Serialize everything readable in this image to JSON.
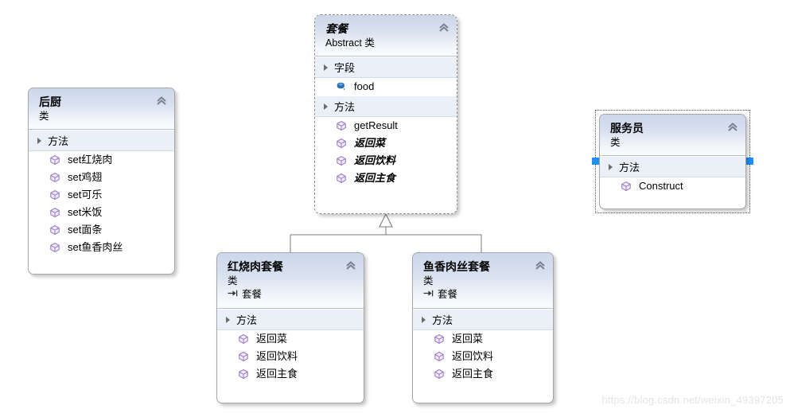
{
  "diagram": {
    "kind": "uml-class-diagram",
    "background": "#ffffff",
    "watermark": "https://blog.csdn.net/weixin_49397205",
    "colors": {
      "header_gradient_top": "#ccd7ea",
      "header_gradient_bottom": "#fbfcfe",
      "section_background": "#eaeff8",
      "shape_border": "#a6a6a6",
      "abstract_border": "#8c8c8c",
      "connector": "#7a7a7a",
      "selection_handle": "#1e90ff",
      "field_icon": "#2a6fb5",
      "method_icon": "#9b7cc8",
      "watermark_color": "#e4e4e4"
    }
  },
  "classes": {
    "kitchen": {
      "name": "后厨",
      "kind": "类",
      "base": null,
      "abstract": false,
      "selected": false,
      "sections": [
        {
          "label": "方法",
          "members": [
            {
              "name": "set红烧肉",
              "icon": "method-icon",
              "abstract": false
            },
            {
              "name": "set鸡翅",
              "icon": "method-icon",
              "abstract": false
            },
            {
              "name": "set可乐",
              "icon": "method-icon",
              "abstract": false
            },
            {
              "name": "set米饭",
              "icon": "method-icon",
              "abstract": false
            },
            {
              "name": "set面条",
              "icon": "method-icon",
              "abstract": false
            },
            {
              "name": "set鱼香肉丝",
              "icon": "method-icon",
              "abstract": false
            }
          ]
        }
      ]
    },
    "meal": {
      "name": "套餐",
      "kind": "Abstract 类",
      "base": null,
      "abstract": true,
      "selected": false,
      "sections": [
        {
          "label": "字段",
          "members": [
            {
              "name": "food",
              "icon": "field-icon",
              "abstract": false
            }
          ]
        },
        {
          "label": "方法",
          "members": [
            {
              "name": "getResult",
              "icon": "method-icon",
              "abstract": false
            },
            {
              "name": "返回菜",
              "icon": "method-icon",
              "abstract": true
            },
            {
              "name": "返回饮料",
              "icon": "method-icon",
              "abstract": true
            },
            {
              "name": "返回主食",
              "icon": "method-icon",
              "abstract": true
            }
          ]
        }
      ]
    },
    "waiter": {
      "name": "服务员",
      "kind": "类",
      "base": null,
      "abstract": false,
      "selected": true,
      "sections": [
        {
          "label": "方法",
          "members": [
            {
              "name": "Construct",
              "icon": "method-icon",
              "abstract": false
            }
          ]
        }
      ]
    },
    "braised_pork_meal": {
      "name": "红烧肉套餐",
      "kind": "类",
      "base": "套餐",
      "abstract": false,
      "selected": false,
      "sections": [
        {
          "label": "方法",
          "members": [
            {
              "name": "返回菜",
              "icon": "method-icon",
              "abstract": false
            },
            {
              "name": "返回饮料",
              "icon": "method-icon",
              "abstract": false
            },
            {
              "name": "返回主食",
              "icon": "method-icon",
              "abstract": false
            }
          ]
        }
      ]
    },
    "fish_pork_meal": {
      "name": "鱼香肉丝套餐",
      "kind": "类",
      "base": "套餐",
      "abstract": false,
      "selected": false,
      "sections": [
        {
          "label": "方法",
          "members": [
            {
              "name": "返回菜",
              "icon": "method-icon",
              "abstract": false
            },
            {
              "name": "返回饮料",
              "icon": "method-icon",
              "abstract": false
            },
            {
              "name": "返回主食",
              "icon": "method-icon",
              "abstract": false
            }
          ]
        }
      ]
    }
  },
  "relationships": [
    {
      "type": "inheritance",
      "from": "红烧肉套餐",
      "to": "套餐"
    },
    {
      "type": "inheritance",
      "from": "鱼香肉丝套餐",
      "to": "套餐"
    }
  ]
}
